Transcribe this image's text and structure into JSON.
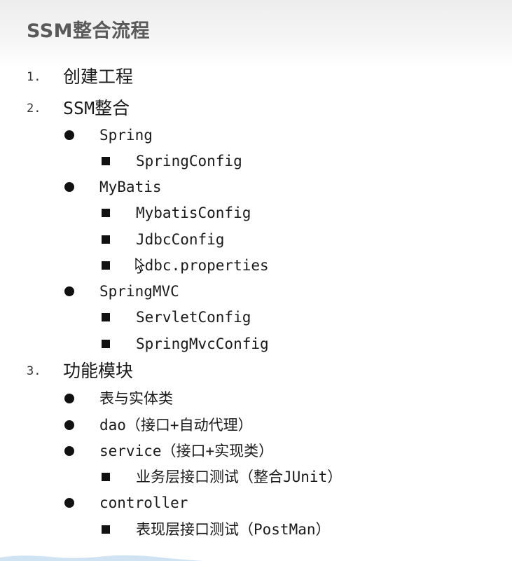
{
  "title": "SSM整合流程",
  "items": [
    {
      "num": "1.",
      "text": "创建工程"
    },
    {
      "num": "2.",
      "text": "SSM整合",
      "children": [
        {
          "text": "Spring",
          "children": [
            {
              "text": "SpringConfig"
            }
          ]
        },
        {
          "text": "MyBatis",
          "children": [
            {
              "text": "MybatisConfig"
            },
            {
              "text": "JdbcConfig"
            },
            {
              "text": "jdbc.properties"
            }
          ]
        },
        {
          "text": "SpringMVC",
          "children": [
            {
              "text": "ServletConfig"
            },
            {
              "text": "SpringMvcConfig"
            }
          ]
        }
      ]
    },
    {
      "num": "3.",
      "text": "功能模块",
      "children": [
        {
          "text": "表与实体类"
        },
        {
          "text": "dao（接口+自动代理）"
        },
        {
          "text": "service（接口+实现类）",
          "children": [
            {
              "text": "业务层接口测试（整合JUnit）"
            }
          ]
        },
        {
          "text": "controller",
          "children": [
            {
              "text": "表现层接口测试（PostMan）"
            }
          ]
        }
      ]
    }
  ]
}
